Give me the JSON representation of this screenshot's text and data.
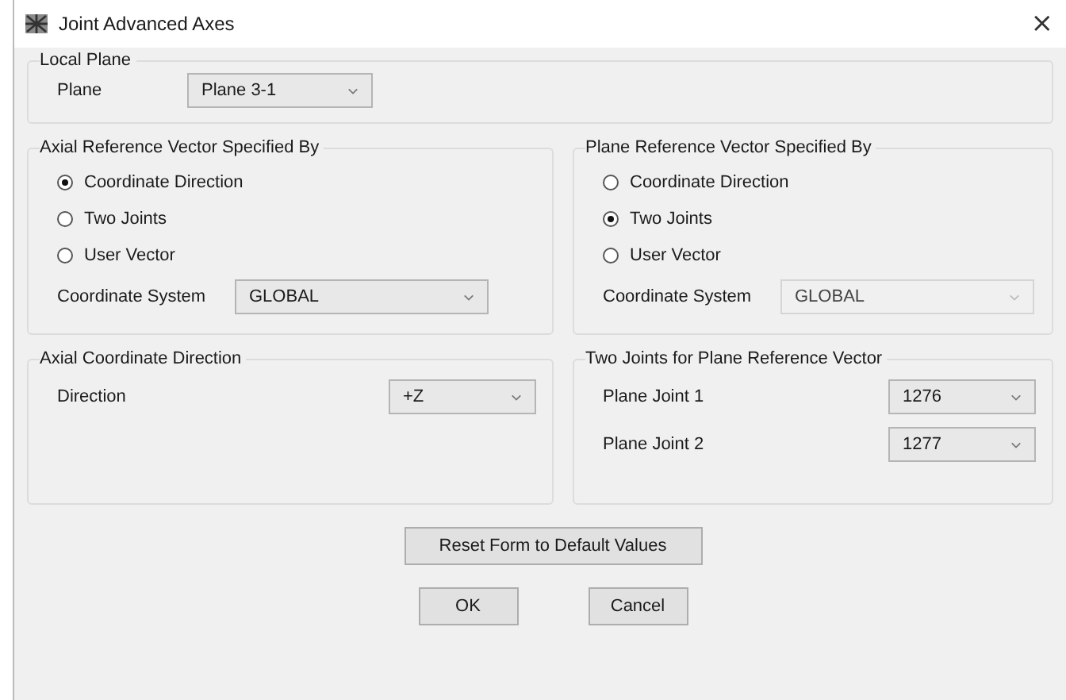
{
  "window": {
    "title": "Joint Advanced Axes",
    "close": "×"
  },
  "local_plane": {
    "title": "Local Plane",
    "label": "Plane",
    "value": "Plane 3-1",
    "disabled": false
  },
  "axial_reference": {
    "title": "Axial Reference Vector Specified By",
    "options": [
      {
        "label": "Coordinate Direction",
        "selected": true
      },
      {
        "label": "Two Joints",
        "selected": false
      },
      {
        "label": "User Vector",
        "selected": false
      }
    ],
    "coordinate_system": {
      "label": "Coordinate System",
      "value": "GLOBAL",
      "disabled": false
    }
  },
  "plane_reference": {
    "title": "Plane Reference Vector Specified By",
    "options": [
      {
        "label": "Coordinate Direction",
        "selected": false
      },
      {
        "label": "Two Joints",
        "selected": true
      },
      {
        "label": "User Vector",
        "selected": false
      }
    ],
    "coordinate_system": {
      "label": "Coordinate System",
      "value": "GLOBAL",
      "disabled": true
    }
  },
  "axial_coordinate_direction": {
    "title": "Axial Coordinate Direction",
    "fields": [
      {
        "label": "Direction",
        "value": "+Z",
        "disabled": false
      }
    ]
  },
  "two_joints": {
    "title": "Two Joints for Plane Reference Vector",
    "fields": [
      {
        "label": "Plane Joint 1",
        "value": "1276",
        "disabled": false
      },
      {
        "label": "Plane Joint 2",
        "value": "1277",
        "disabled": false
      }
    ]
  },
  "buttons": {
    "reset": "Reset Form to Default Values",
    "ok": "OK",
    "cancel": "Cancel"
  }
}
